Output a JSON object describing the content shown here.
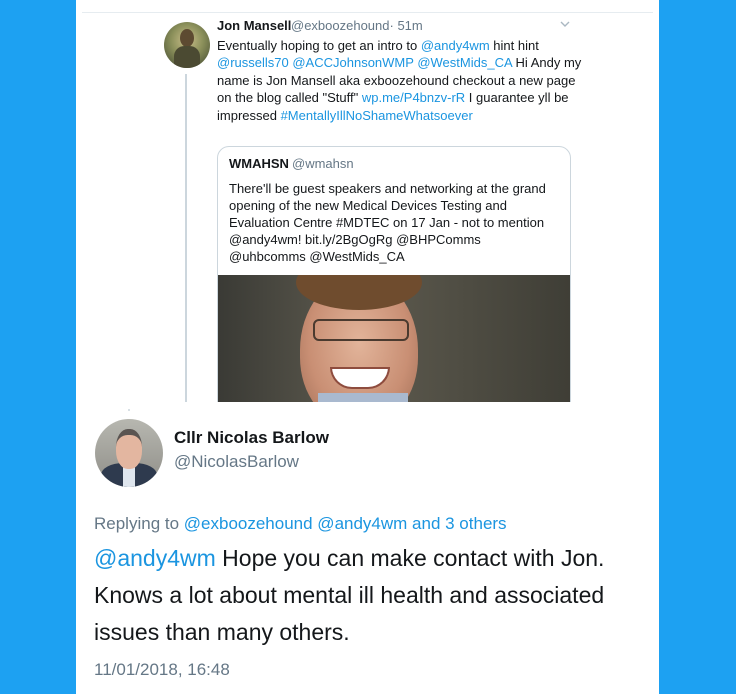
{
  "thread_tweet": {
    "author_name": "Jon Mansell",
    "handle": "@exboozehound",
    "time": "· 51m",
    "text_parts": [
      {
        "text": "Eventually hoping to get an intro to ",
        "link": false
      },
      {
        "text": "@andy4wm",
        "link": true
      },
      {
        "text": " hint hint ",
        "link": false
      },
      {
        "text": "@russells70",
        "link": true
      },
      {
        "text": " ",
        "link": false
      },
      {
        "text": "@ACCJohnsonWMP",
        "link": true
      },
      {
        "text": " ",
        "link": false
      },
      {
        "text": "@WestMids_CA",
        "link": true
      },
      {
        "text": " Hi Andy my name is Jon Mansell aka exboozehound checkout a new page on the blog called \"Stuff\" ",
        "link": false
      },
      {
        "text": "wp.me/P4bnzv-rR",
        "link": true
      },
      {
        "text": " I guarantee yll be impressed ",
        "link": false
      },
      {
        "text": "#MentallyIllNoShameWhatsoever",
        "link": true
      }
    ],
    "quoted": {
      "author_name": "WMAHSN",
      "handle": "@wmahsn",
      "text": "There'll be guest speakers and networking at the grand opening of the new Medical Devices Testing and Evaluation Centre #MDTEC on 17 Jan - not to mention @andy4wm! bit.ly/2BgOgRg @BHPComms @uhbcomms @WestMids_CA"
    }
  },
  "main_tweet": {
    "author_name": "Cllr Nicolas Barlow",
    "handle": "@NicolasBarlow",
    "replying_label": "Replying to ",
    "replying_to": "@exboozehound @andy4wm and 3 others",
    "mention": "@andy4wm",
    "text": " Hope you can make contact with Jon. Knows a lot about mental ill health and associated issues than many others.",
    "timestamp": "11/01/2018, 16:48"
  },
  "colors": {
    "background": "#1da1f2",
    "link": "#1b95e0",
    "secondary_text": "#657786",
    "primary_text": "#14171a"
  }
}
